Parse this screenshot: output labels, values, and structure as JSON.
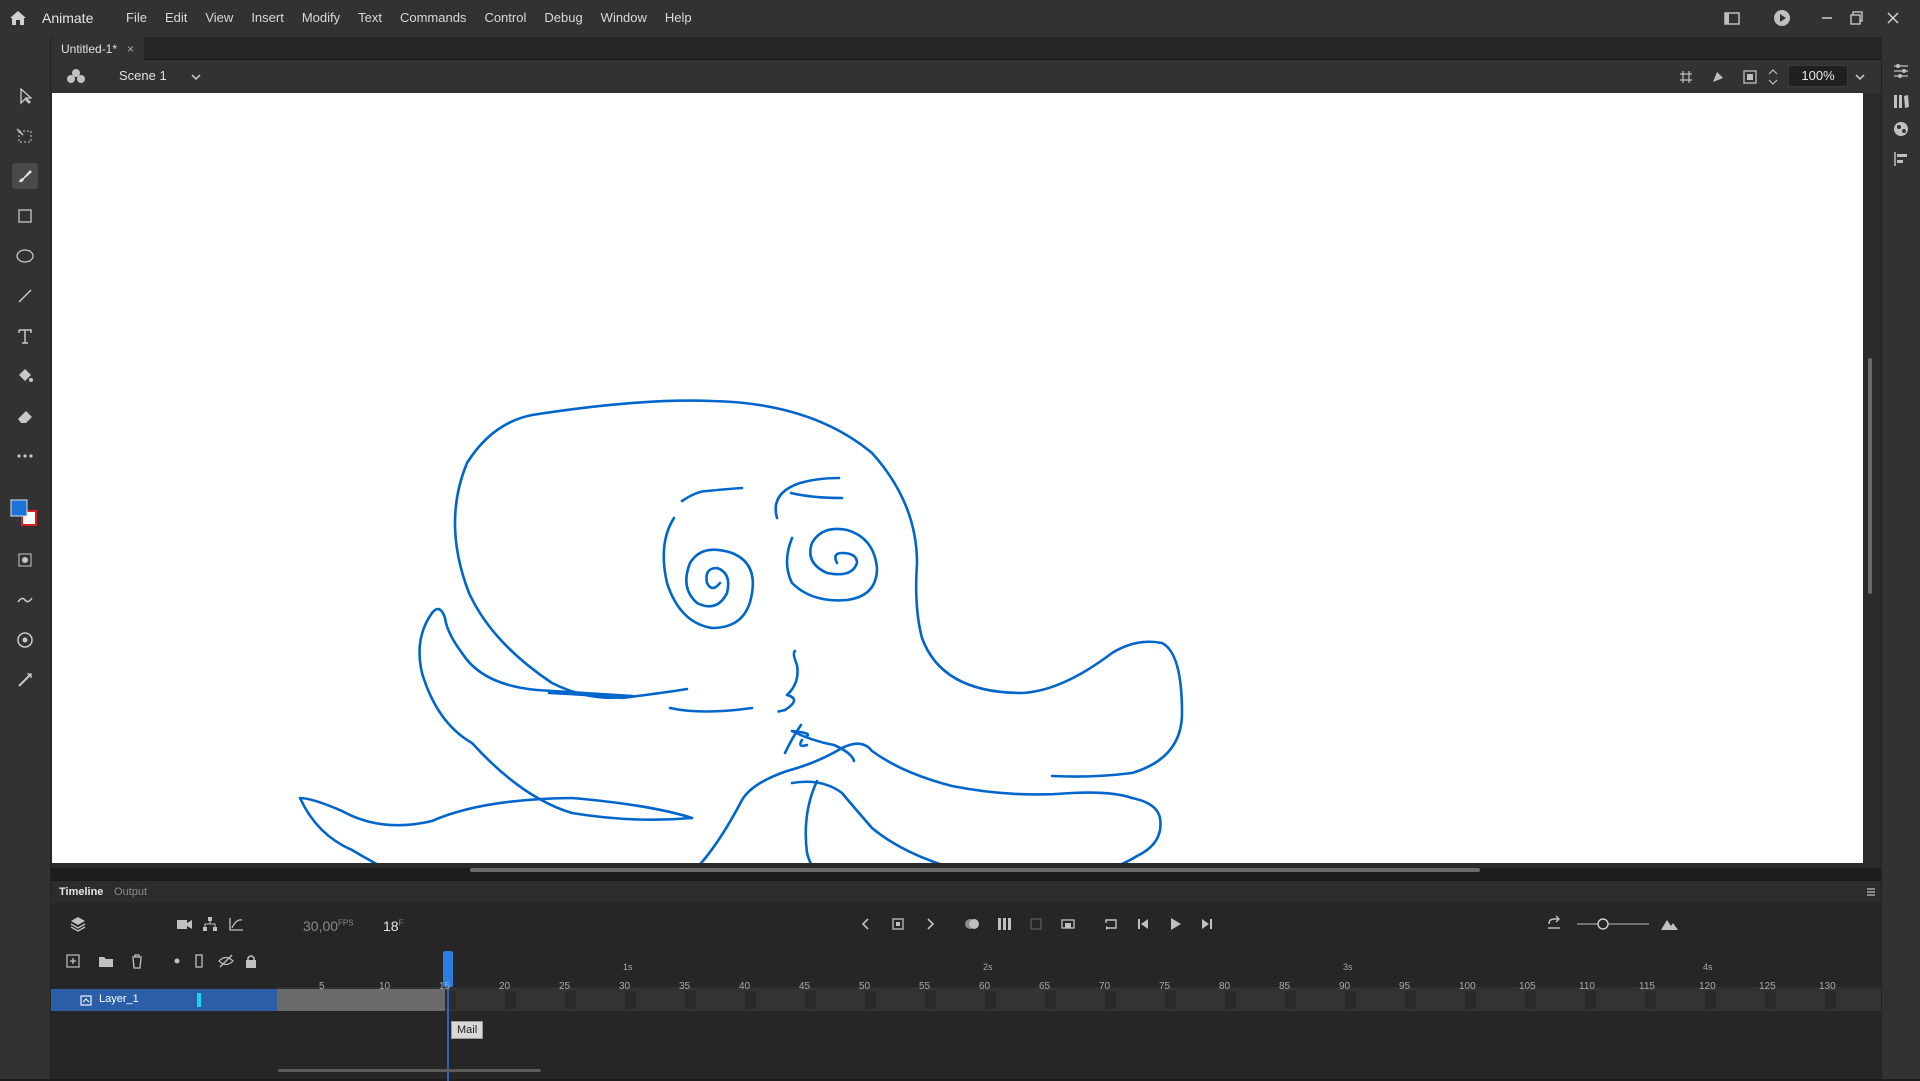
{
  "app": {
    "name": "Animate"
  },
  "menu": [
    "File",
    "Edit",
    "View",
    "Insert",
    "Modify",
    "Text",
    "Commands",
    "Control",
    "Debug",
    "Window",
    "Help"
  ],
  "document": {
    "tab_title": "Untitled-1*",
    "close_glyph": "×"
  },
  "scene": {
    "name": "Scene 1",
    "zoom": "100%"
  },
  "colors": {
    "stroke": "#0066cc",
    "fill": "#1a73d8",
    "stage": "#ffffff",
    "accent": "#2b5ea7",
    "layer_color": "#14d6ef"
  },
  "timeline": {
    "tabs": [
      "Timeline",
      "Output"
    ],
    "fps": "30,00",
    "fps_unit": "FPS",
    "current_frame": "18",
    "frame_unit": "F",
    "layer_name": "Layer_1",
    "tooltip": "Mail",
    "seconds": [
      "1s",
      "2s",
      "3s",
      "4s"
    ],
    "frame_ticks": [
      "5",
      "10",
      "15",
      "20",
      "25",
      "30",
      "35",
      "40",
      "45",
      "50",
      "55",
      "60",
      "65",
      "70",
      "75",
      "80",
      "85",
      "90",
      "95",
      "100",
      "105",
      "110",
      "115",
      "120",
      "125",
      "130"
    ]
  },
  "icons": {
    "tools": [
      "selection-icon",
      "free-transform-icon",
      "brush-icon",
      "rectangle-icon",
      "oval-icon",
      "line-icon",
      "text-icon",
      "paint-bucket-icon",
      "eraser-icon",
      "more-tools-icon"
    ],
    "right_panel": [
      "properties-icon",
      "library-icon",
      "assets-icon",
      "align-icon"
    ]
  }
}
